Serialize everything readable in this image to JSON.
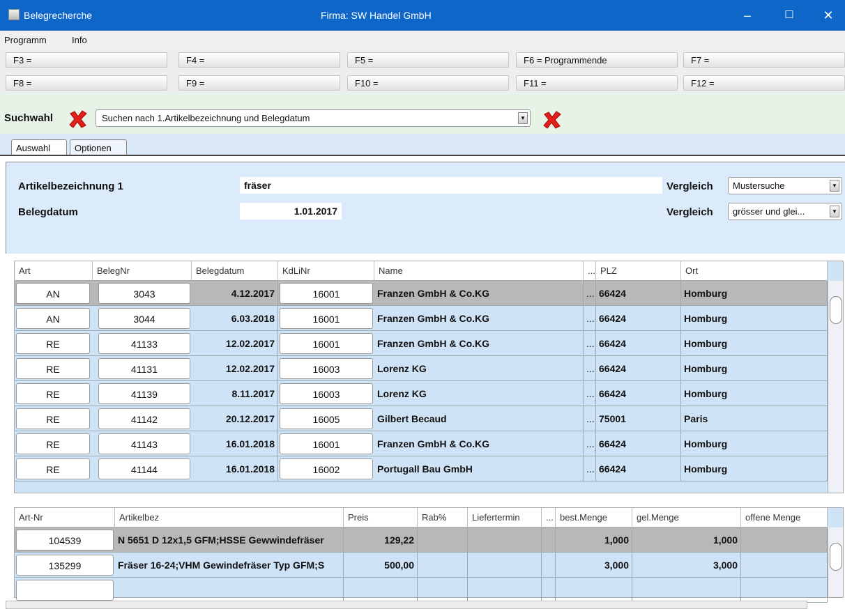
{
  "window": {
    "title": "Belegrecherche",
    "company": "Firma: SW Handel GmbH"
  },
  "menu": [
    "Programm",
    "Info"
  ],
  "fkeys": {
    "row1": [
      "F3 =",
      "F4 =",
      "F5 =",
      "F6 = Programmende",
      "F7 ="
    ],
    "row2": [
      "F8 =",
      "F9 =",
      "F10 =",
      "F11 =",
      "F12 ="
    ]
  },
  "search": {
    "label": "Suchwahl",
    "selected": "Suchen nach 1.Artikelbezeichnung und Belegdatum"
  },
  "tabs": [
    "Auswahl",
    "Optionen"
  ],
  "form": {
    "article_label": "Artikelbezeichnung 1",
    "article_value": "fräser",
    "date_label": "Belegdatum",
    "date_value": "1.01.2017",
    "cmp_label": "Vergleich",
    "cmp1_value": "Mustersuche",
    "cmp2_value": "grösser und glei..."
  },
  "table1": {
    "headers": [
      "Art",
      "BelegNr",
      "Belegdatum",
      "KdLiNr",
      "Name",
      "...",
      "PLZ",
      "Ort"
    ],
    "rows": [
      {
        "art": "AN",
        "beleg": "3043",
        "datum": "4.12.2017",
        "kdli": "16001",
        "name": "Franzen  GmbH & Co.KG",
        "dots": "...",
        "plz": "66424",
        "ort": "Homburg"
      },
      {
        "art": "AN",
        "beleg": "3044",
        "datum": "6.03.2018",
        "kdli": "16001",
        "name": "Franzen  GmbH & Co.KG",
        "dots": "...",
        "plz": "66424",
        "ort": "Homburg"
      },
      {
        "art": "RE",
        "beleg": "41133",
        "datum": "12.02.2017",
        "kdli": "16001",
        "name": "Franzen  GmbH & Co.KG",
        "dots": "...",
        "plz": "66424",
        "ort": "Homburg"
      },
      {
        "art": "RE",
        "beleg": "41131",
        "datum": "12.02.2017",
        "kdli": "16003",
        "name": "Lorenz KG",
        "dots": "...",
        "plz": "66424",
        "ort": "Homburg"
      },
      {
        "art": "RE",
        "beleg": "41139",
        "datum": "8.11.2017",
        "kdli": "16003",
        "name": "Lorenz KG",
        "dots": "...",
        "plz": "66424",
        "ort": "Homburg"
      },
      {
        "art": "RE",
        "beleg": "41142",
        "datum": "20.12.2017",
        "kdli": "16005",
        "name": "Gilbert Becaud",
        "dots": "...",
        "plz": "75001",
        "ort": "Paris"
      },
      {
        "art": "RE",
        "beleg": "41143",
        "datum": "16.01.2018",
        "kdli": "16001",
        "name": "Franzen  GmbH & Co.KG",
        "dots": "...",
        "plz": "66424",
        "ort": "Homburg"
      },
      {
        "art": "RE",
        "beleg": "41144",
        "datum": "16.01.2018",
        "kdli": "16002",
        "name": "Portugall Bau GmbH",
        "dots": "...",
        "plz": "66424",
        "ort": "Homburg"
      }
    ]
  },
  "table2": {
    "headers": [
      "Art-Nr",
      "Artikelbez",
      "Preis",
      "Rab%",
      "Liefertermin",
      "...",
      "best.Menge",
      "gel.Menge",
      "offene Menge"
    ],
    "rows": [
      {
        "artnr": "104539",
        "bez": "N 5651 D 12x1,5  GFM;HSSE Gewwindefräser",
        "preis": "129,22",
        "rab": "",
        "liefer": "",
        "dots": "",
        "best": "1,000",
        "gel": "1,000",
        "offen": ""
      },
      {
        "artnr": "135299",
        "bez": "Fräser 16-24;VHM Gewindefräser Typ GFM;S",
        "preis": "500,00",
        "rab": "",
        "liefer": "",
        "dots": "",
        "best": "3,000",
        "gel": "3,000",
        "offen": ""
      },
      {
        "artnr": "",
        "bez": "",
        "preis": "",
        "rab": "",
        "liefer": "",
        "dots": "",
        "best": "",
        "gel": "",
        "offen": ""
      }
    ]
  },
  "colors": {
    "titlebar": "#0f66c9",
    "panel": "#dcebfb",
    "row": "#cfe3f7",
    "selected_row": "#b8b8b8"
  }
}
